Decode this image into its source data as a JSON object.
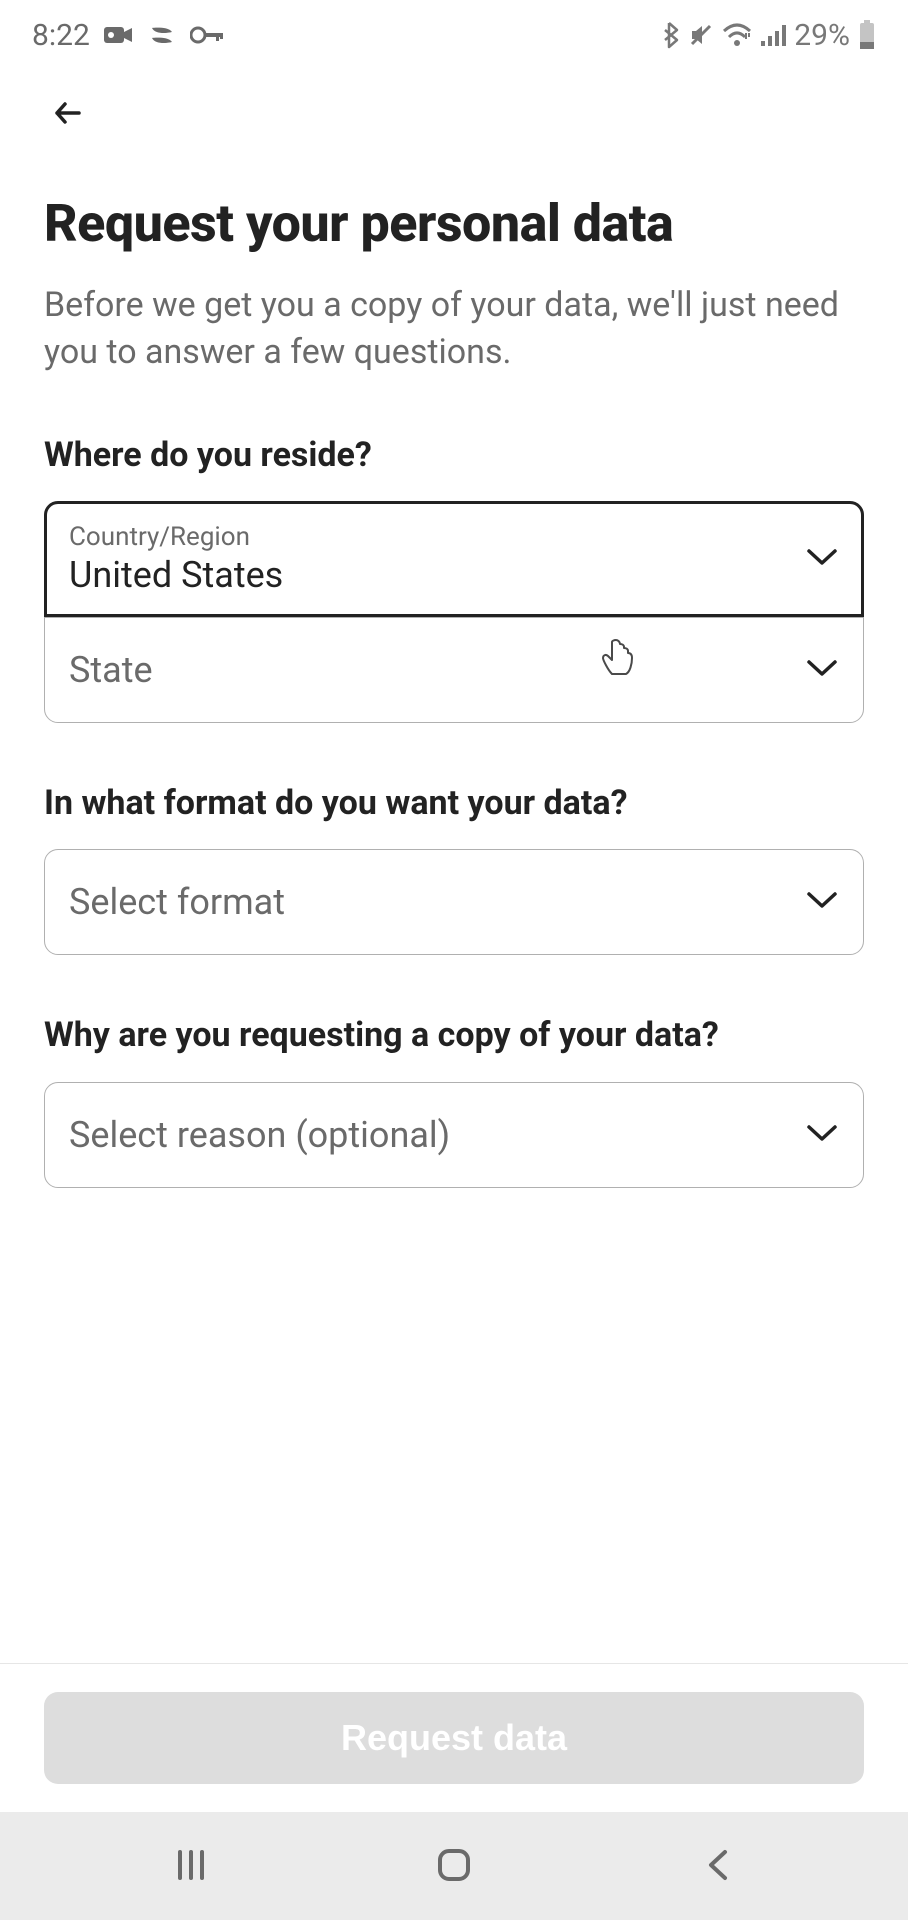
{
  "status_bar": {
    "time": "8:22",
    "battery_percent": "29%"
  },
  "page": {
    "title": "Request your personal data",
    "subtitle": "Before we get you a copy of your data, we'll just need you to answer a few questions."
  },
  "sections": {
    "reside": {
      "label": "Where do you reside?",
      "country_field": {
        "label": "Country/Region",
        "value": "United States"
      },
      "state_field": {
        "placeholder": "State"
      }
    },
    "format": {
      "label": "In what format do you want your data?",
      "field": {
        "placeholder": "Select format"
      }
    },
    "reason": {
      "label": "Why are you requesting a copy of your data?",
      "field": {
        "placeholder": "Select reason (optional)"
      }
    }
  },
  "actions": {
    "request_label": "Request data"
  }
}
